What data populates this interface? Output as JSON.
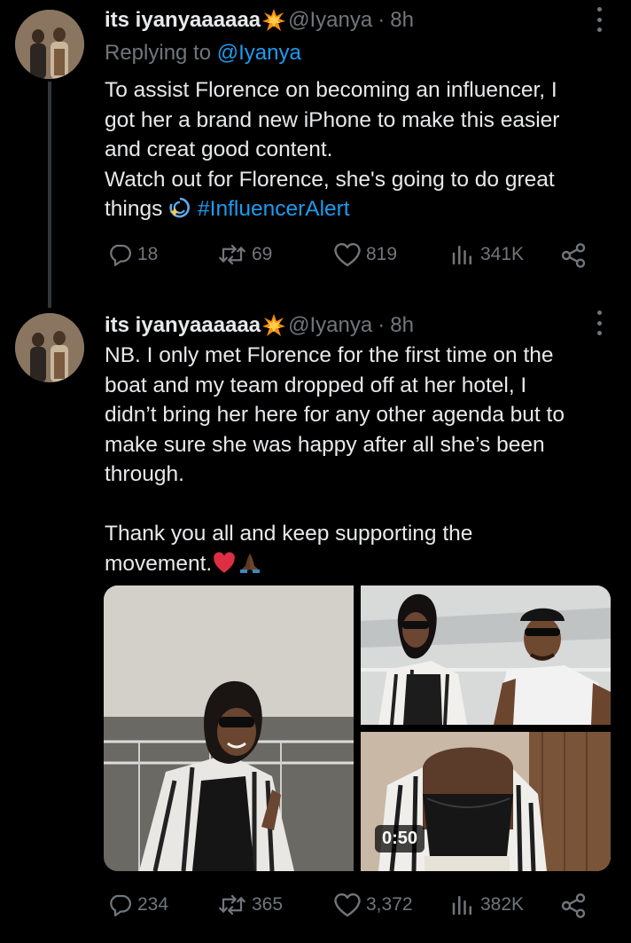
{
  "tweets": [
    {
      "author_name": "its iyanyaaaaaa",
      "name_emoji": "collision-emoji",
      "handle": "@Iyanya",
      "separator": "·",
      "time": "8h",
      "replying_prefix": "Replying to",
      "replying_to": "@Iyanya",
      "text_lines": [
        "To assist Florence on becoming an influencer, I",
        "got her a brand new iPhone to make this easier",
        "and creat good content.",
        "Watch out for Florence, she's going to do great",
        "things"
      ],
      "hashtag": "#InfluencerAlert",
      "stats": {
        "replies": "18",
        "reposts": "69",
        "likes": "819",
        "views": "341K"
      }
    },
    {
      "author_name": "its iyanyaaaaaa",
      "name_emoji": "collision-emoji",
      "handle": "@Iyanya",
      "separator": "·",
      "time": "8h",
      "text_lines": [
        "NB. I only met Florence for the first time on the",
        "boat and my team dropped off at her hotel, I",
        "didn’t bring her here for any other agenda but to",
        "make sure she was happy after all she’s been",
        "through.",
        "",
        "Thank you all and keep supporting the",
        "movement."
      ],
      "media": {
        "video_duration": "0:50"
      },
      "stats": {
        "replies": "234",
        "reposts": "365",
        "likes": "3,372",
        "views": "382K"
      }
    }
  ],
  "colors": {
    "background": "#000000",
    "text": "#e7e9ea",
    "muted": "#71767b",
    "link": "#1d9bf0",
    "thread_line": "#333639"
  },
  "icons": [
    "reply-icon",
    "repost-icon",
    "like-icon",
    "views-icon",
    "share-icon",
    "more-icon",
    "dizzy-emoji",
    "red-heart-emoji",
    "folded-hands-emoji"
  ]
}
